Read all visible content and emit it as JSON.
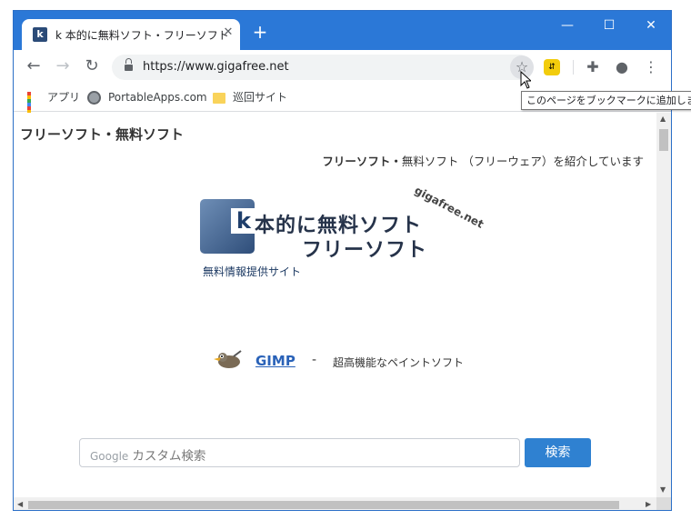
{
  "browser": {
    "tab": {
      "favicon_letter": "k",
      "title": "k 本的に無料ソフト・フリーソフト",
      "close": "✕"
    },
    "new_tab": "+",
    "window_controls": {
      "minimize": "—",
      "maximize": "☐",
      "close": "✕"
    },
    "nav": {
      "back": "←",
      "forward": "→",
      "reload": "↻"
    },
    "address": {
      "url": "https://www.gigafree.net"
    },
    "star": "☆",
    "extension_label": "⇵",
    "puzzle": "✚",
    "profile": "●",
    "menu": "⋮",
    "tooltip": "このページをブックマークに追加します",
    "bookmarks": [
      {
        "label": "アプリ",
        "icon": "apps-grid-icon"
      },
      {
        "label": "PortableApps.com",
        "icon": "portableapps-icon"
      },
      {
        "label": "巡回サイト",
        "icon": "folder-icon"
      }
    ],
    "apps_colors": [
      "#ea4335",
      "#fbbc04",
      "#34a853",
      "#4285f4",
      "#ea4335",
      "#fbbc04",
      "#34a853",
      "#4285f4",
      "#ea4335"
    ]
  },
  "page": {
    "heading": "フリーソフト・無料ソフト",
    "lead_bold": "フリーソフト・",
    "lead_rest": "無料ソフト （フリーウェア）を紹介しています",
    "logo": {
      "box_letter": "k",
      "line1": "本的に無料ソフト",
      "line2": "フリーソフト",
      "domain": "gigafree.net",
      "sub": "無料情報提供サイト"
    },
    "featured": {
      "link": "GIMP",
      "dash": "-",
      "desc": "超高機能なペイントソフト"
    },
    "search": {
      "brand": "Google",
      "placeholder": "カスタム検索",
      "button": "検索"
    }
  }
}
